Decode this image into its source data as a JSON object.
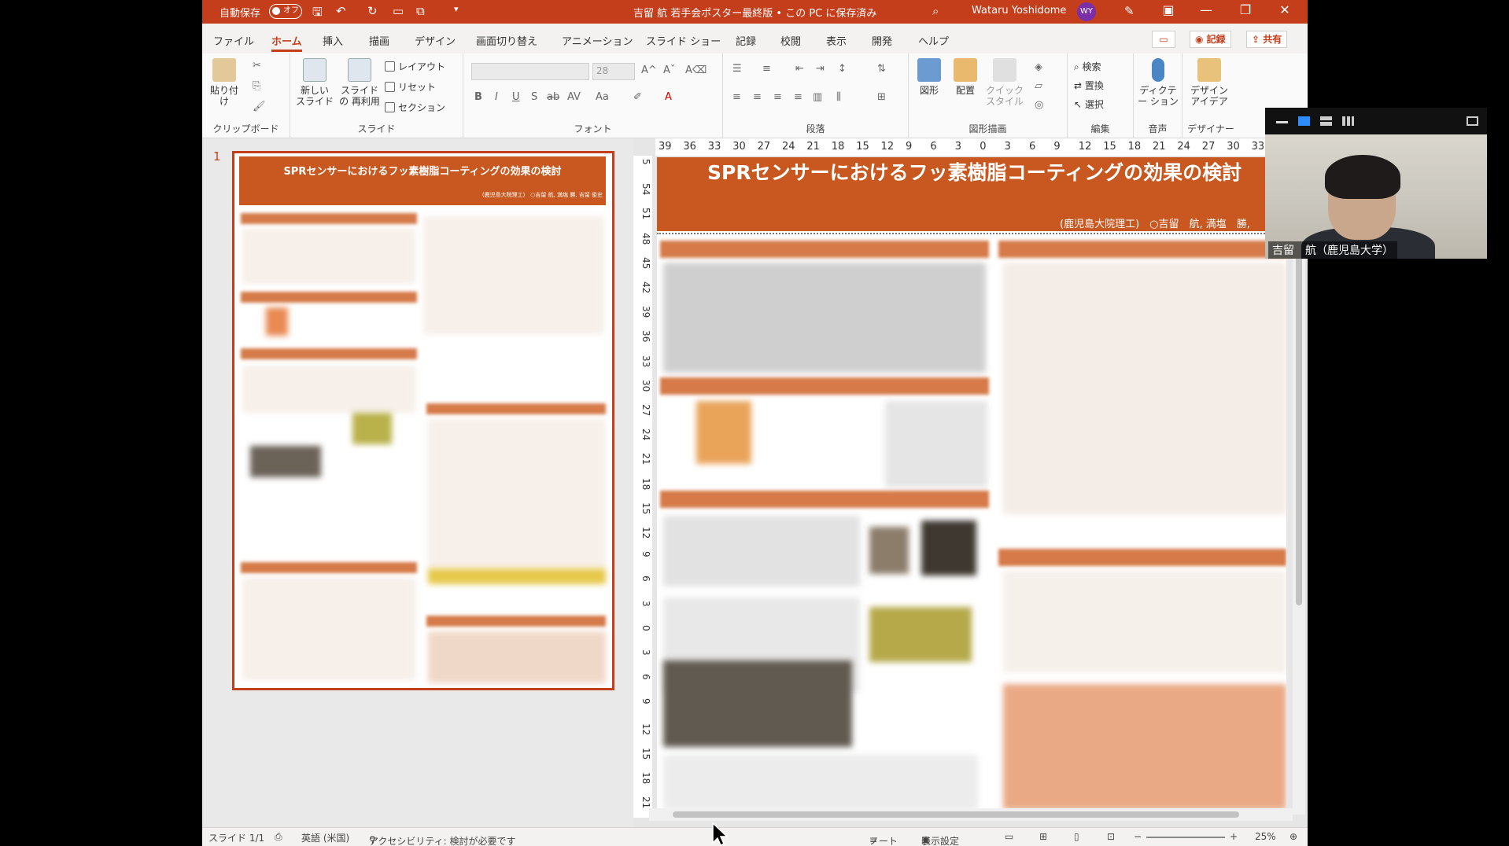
{
  "titlebar": {
    "autosave_label": "自動保存",
    "autosave_state": "オフ",
    "doc_title": "吉留 航 若手会ポスター最終版 • この PC に保存済み",
    "user_name": "Wataru Yoshidome",
    "user_initials": "WY"
  },
  "tabs": [
    "ファイル",
    "ホーム",
    "挿入",
    "描画",
    "デザイン",
    "画面切り替え",
    "アニメーション",
    "スライド ショー",
    "記録",
    "校閲",
    "表示",
    "開発",
    "ヘルプ"
  ],
  "tab_actions": {
    "record": "記録",
    "share": "共有"
  },
  "ribbon": {
    "clipboard": {
      "paste": "貼り付け",
      "label": "クリップボード"
    },
    "slides": {
      "new_slide": "新しい スライド",
      "reuse": "スライドの 再利用",
      "layout": "レイアウト",
      "reset": "リセット",
      "section": "セクション",
      "label": "スライド"
    },
    "font": {
      "size": "28",
      "label": "フォント"
    },
    "paragraph": {
      "label": "段落"
    },
    "drawing": {
      "shapes": "図形",
      "arrange": "配置",
      "quick_styles": "クイック スタイル",
      "label": "図形描画"
    },
    "editing": {
      "find": "検索",
      "replace": "置換",
      "select": "選択",
      "label": "編集"
    },
    "voice": {
      "dictate": "ディクテー ション",
      "label": "音声"
    },
    "designer": {
      "ideas": "デザイン アイデア",
      "label": "デザイナー"
    }
  },
  "thumbnail": {
    "number": "1",
    "title": "SPRセンサーにおけるフッ素樹脂コーティングの効果の検討",
    "authors": "(鹿児島大院理工)　○吉留 航, 満塩 勝, 吉留 俊史"
  },
  "slide": {
    "title": "SPRセンサーにおけるフッ素樹脂コーティングの効果の検討",
    "affiliation": "(鹿児島大院理工)",
    "authors": "○吉留　航, 満塩　勝,"
  },
  "ruler": {
    "h_ticks": [
      "39",
      "36",
      "33",
      "30",
      "27",
      "24",
      "21",
      "18",
      "15",
      "12",
      "9",
      "6",
      "3",
      "0",
      "3",
      "6",
      "9",
      "12",
      "15",
      "18",
      "21",
      "24",
      "27",
      "30",
      "33"
    ],
    "v_ticks": [
      "5",
      "54",
      "51",
      "48",
      "45",
      "42",
      "39",
      "36",
      "33",
      "30",
      "27",
      "24",
      "21",
      "18",
      "15",
      "12",
      "9",
      "6",
      "3",
      "0",
      "3",
      "6",
      "9",
      "12",
      "15",
      "18",
      "21"
    ]
  },
  "statusbar": {
    "slide": "スライド 1/1",
    "language": "英語 (米国)",
    "accessibility": "アクセシビリティ: 検討が必要です",
    "notes": "ノート",
    "display_settings": "表示設定",
    "zoom": "25%"
  },
  "video": {
    "participant": "吉留　航（鹿児島大学）"
  },
  "colors": {
    "accent": "#c43e1c",
    "poster_orange": "#c8581f"
  }
}
